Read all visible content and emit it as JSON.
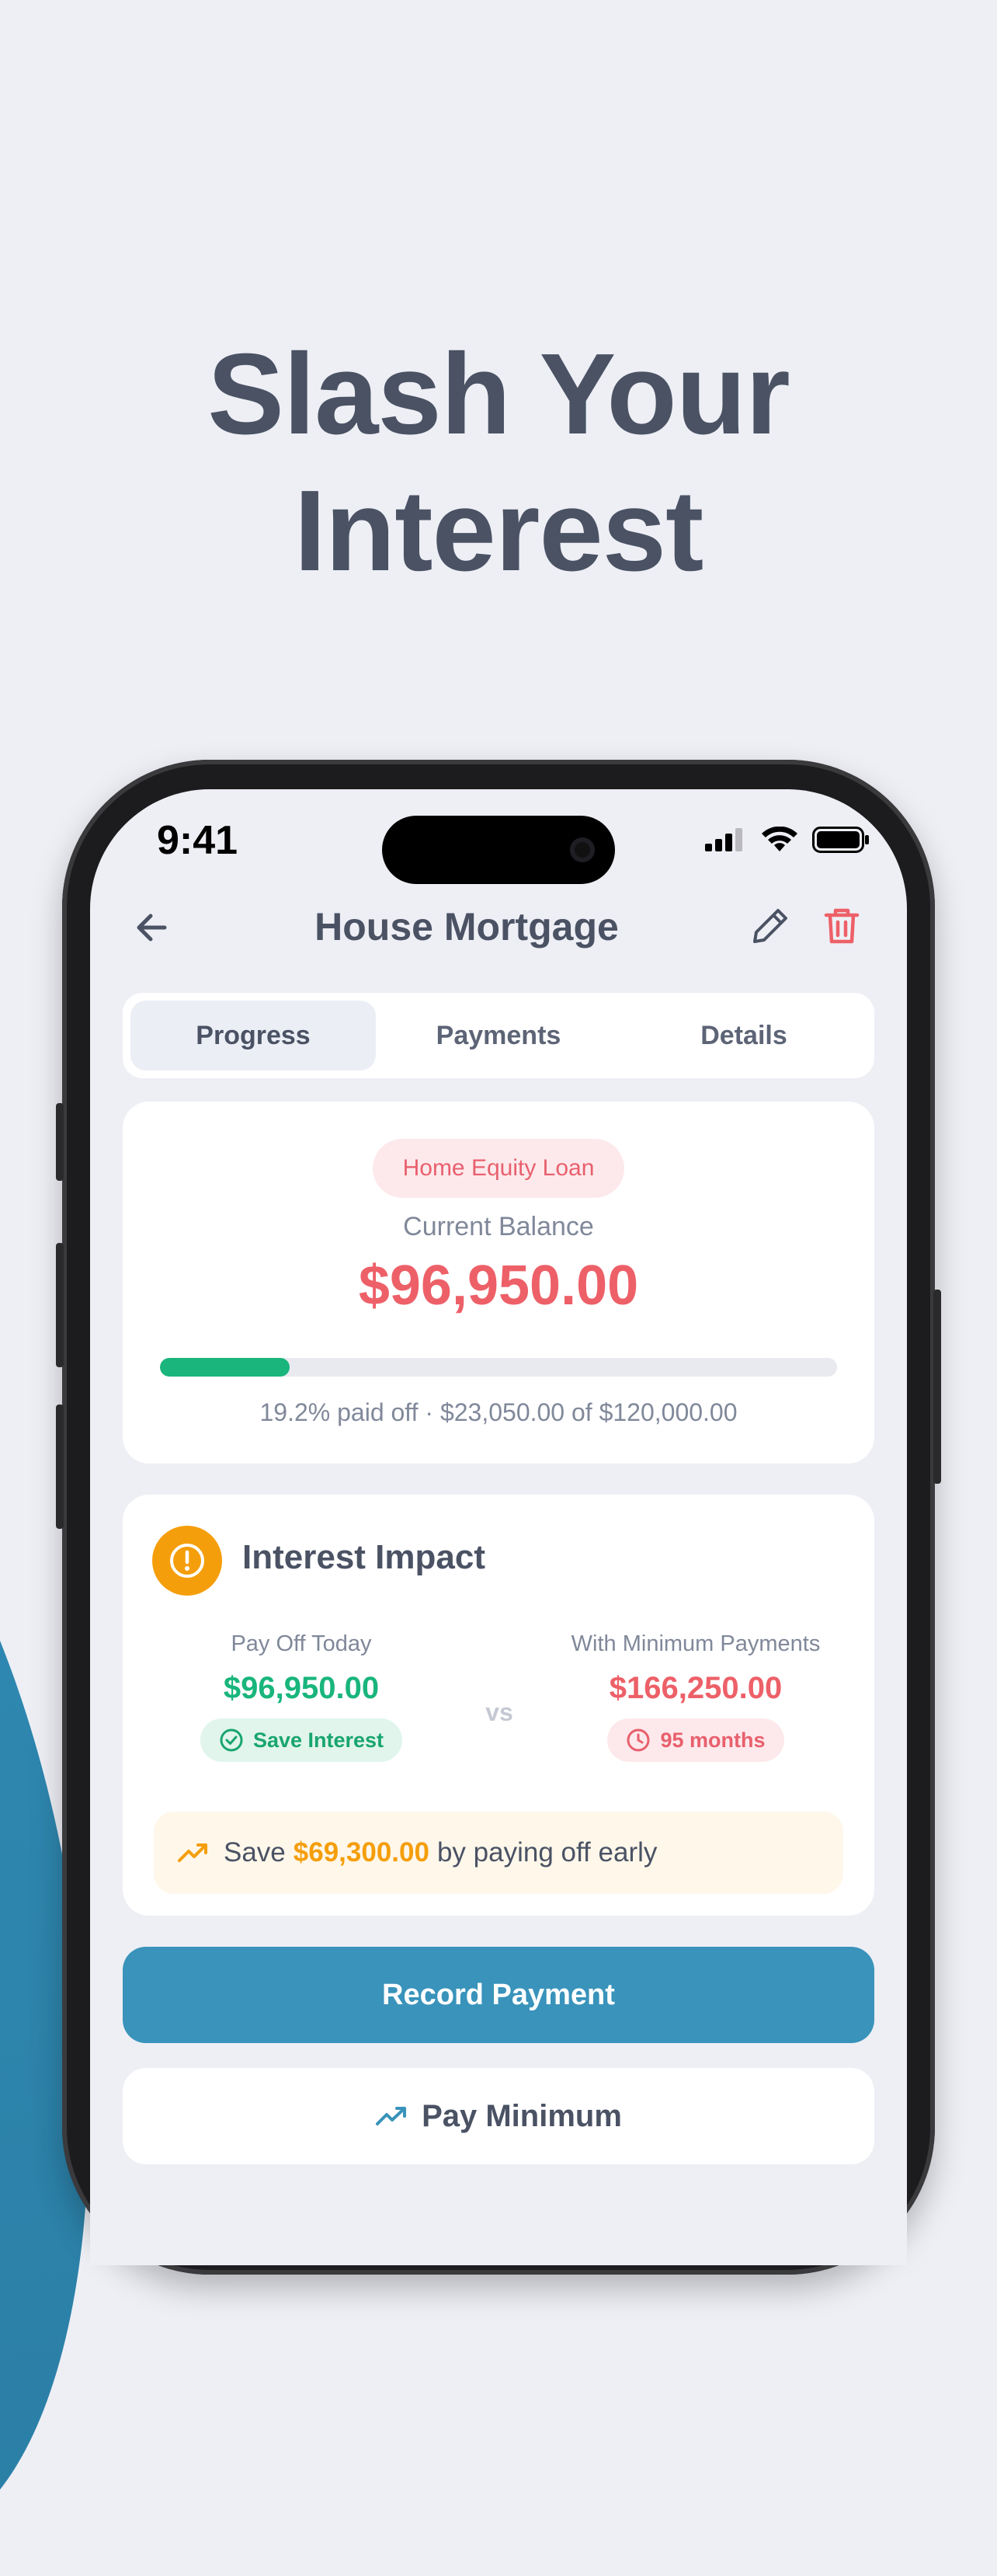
{
  "headline": {
    "line1": "Slash Your",
    "line2": "Interest"
  },
  "status_bar": {
    "time": "9:41"
  },
  "nav": {
    "title": "House Mortgage"
  },
  "tabs": [
    {
      "label": "Progress",
      "active": true
    },
    {
      "label": "Payments",
      "active": false
    },
    {
      "label": "Details",
      "active": false
    }
  ],
  "balance_card": {
    "loan_type": "Home Equity Loan",
    "balance_label": "Current Balance",
    "balance": "$96,950.00",
    "progress_fraction": 0.192,
    "progress_text": "19.2% paid off · $23,050.00 of $120,000.00"
  },
  "interest_card": {
    "title": "Interest Impact",
    "pay_off_today": {
      "label": "Pay Off Today",
      "amount": "$96,950.00",
      "chip": "Save Interest"
    },
    "vs": "vs",
    "minimum": {
      "label": "With Minimum Payments",
      "amount": "$166,250.00",
      "chip": "95 months"
    },
    "savings": {
      "prefix": "Save",
      "amount": "$69,300.00",
      "suffix": "by paying off early"
    }
  },
  "actions": {
    "record": "Record Payment",
    "pay_minimum": "Pay Minimum"
  },
  "colors": {
    "accent": "#3993bb",
    "green": "#19b57c",
    "red": "#ed6068",
    "amber": "#f59e0b"
  },
  "icons": [
    "back-arrow-icon",
    "edit-pencil-icon",
    "trash-icon",
    "warning-icon",
    "check-circle-icon",
    "clock-icon",
    "trending-up-icon",
    "signal-icon",
    "wifi-icon",
    "battery-icon"
  ]
}
